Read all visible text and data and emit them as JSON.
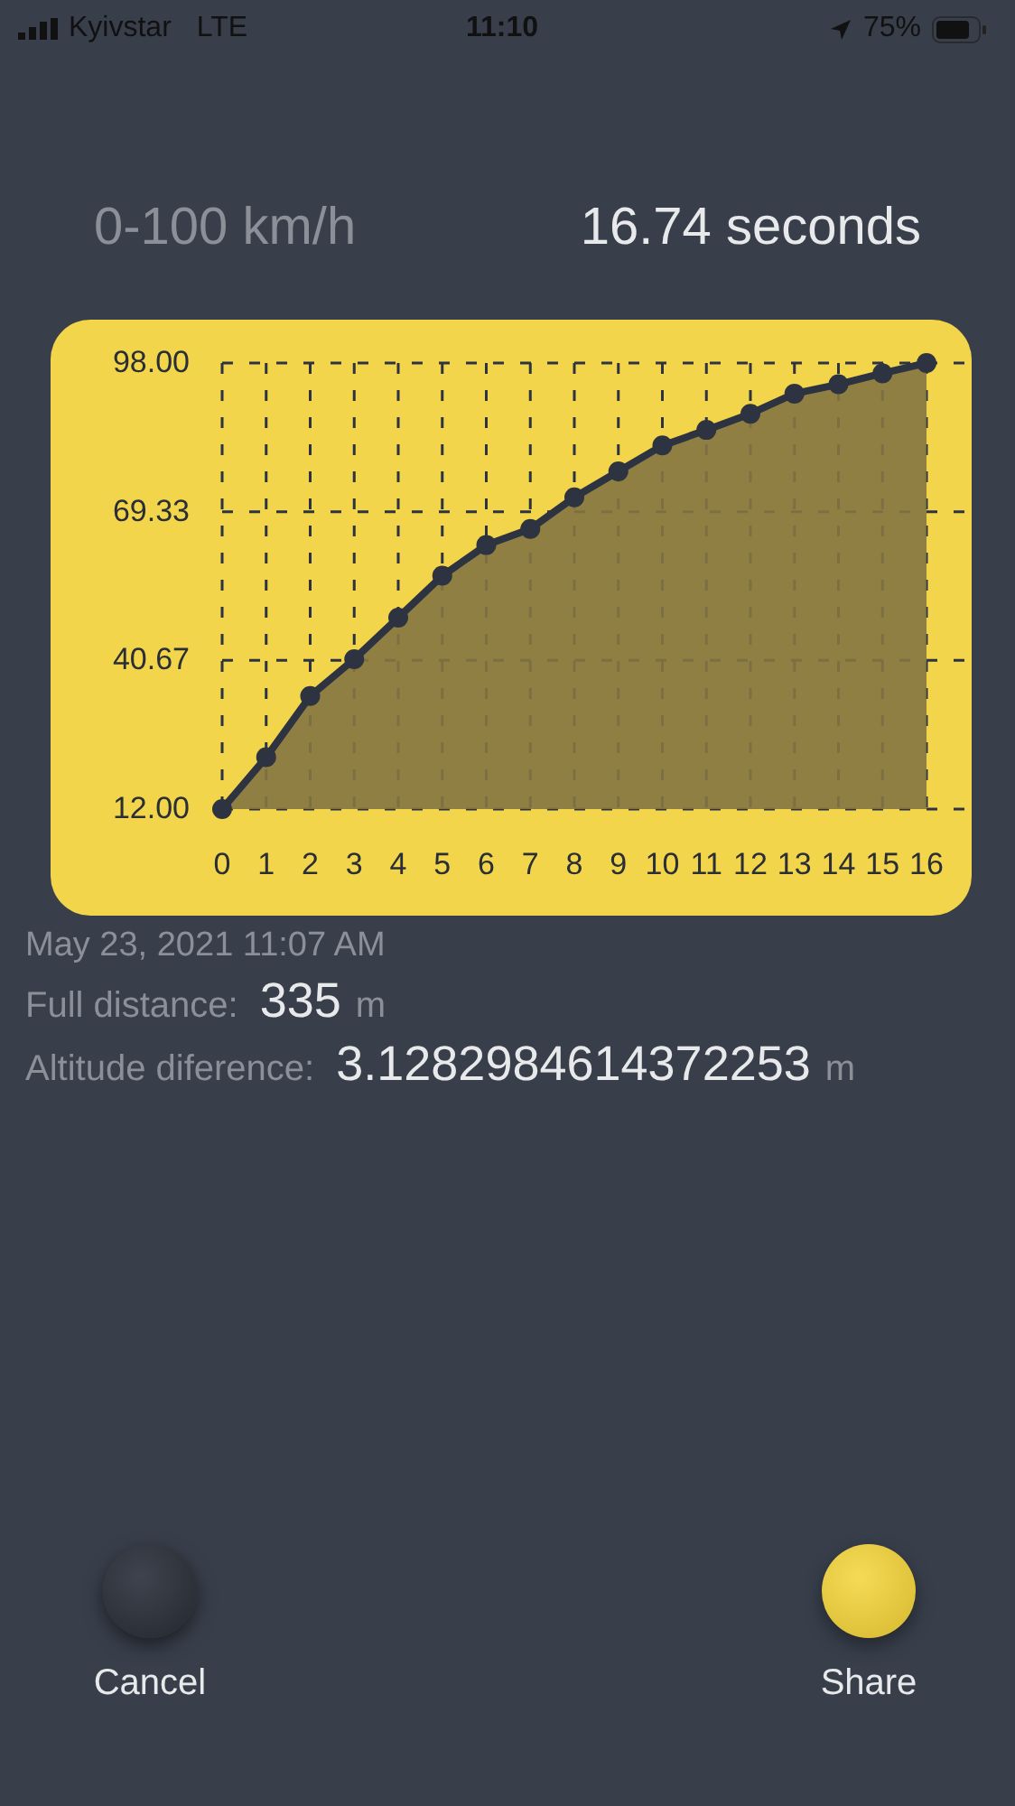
{
  "status_bar": {
    "carrier": "Kyivstar",
    "network": "LTE",
    "time": "11:10",
    "battery": "75%"
  },
  "header": {
    "label": "0-100 km/h",
    "value": "16.74 seconds"
  },
  "chart": {
    "chart_data": {
      "type": "area",
      "x": [
        0,
        1,
        2,
        3,
        4,
        5,
        6,
        7,
        8,
        9,
        10,
        11,
        12,
        13,
        14,
        15,
        16
      ],
      "series": [
        {
          "color": "#857642",
          "values": [
            12,
            22,
            33.8,
            40.9,
            48.9,
            57,
            62.9,
            66,
            72.1,
            77.1,
            82.1,
            85.1,
            88.2,
            92.1,
            93.9,
            96,
            98
          ]
        }
      ],
      "xlim": [
        0,
        16
      ],
      "ylim": [
        12,
        98
      ],
      "grid": true,
      "yticks": [
        {
          "value": 12,
          "label": "12.00"
        },
        {
          "value": 40.67,
          "label": "40.67"
        },
        {
          "value": 69.33,
          "label": "69.33"
        },
        {
          "value": 98,
          "label": "98.00"
        }
      ],
      "xticks": [
        0,
        1,
        2,
        3,
        4,
        5,
        6,
        7,
        8,
        9,
        10,
        11,
        12,
        13,
        14,
        15,
        16
      ]
    }
  },
  "date": "May 23, 2021 11:07 AM",
  "stats": [
    {
      "label": "Full distance:",
      "value": "335",
      "unit": "m"
    },
    {
      "label": "Altitude diference:",
      "value": "3.1282984614372253",
      "unit": "m"
    }
  ],
  "buttons": [
    {
      "kind": "dark",
      "label": "Cancel"
    },
    {
      "kind": "accent",
      "label": "Share"
    }
  ]
}
